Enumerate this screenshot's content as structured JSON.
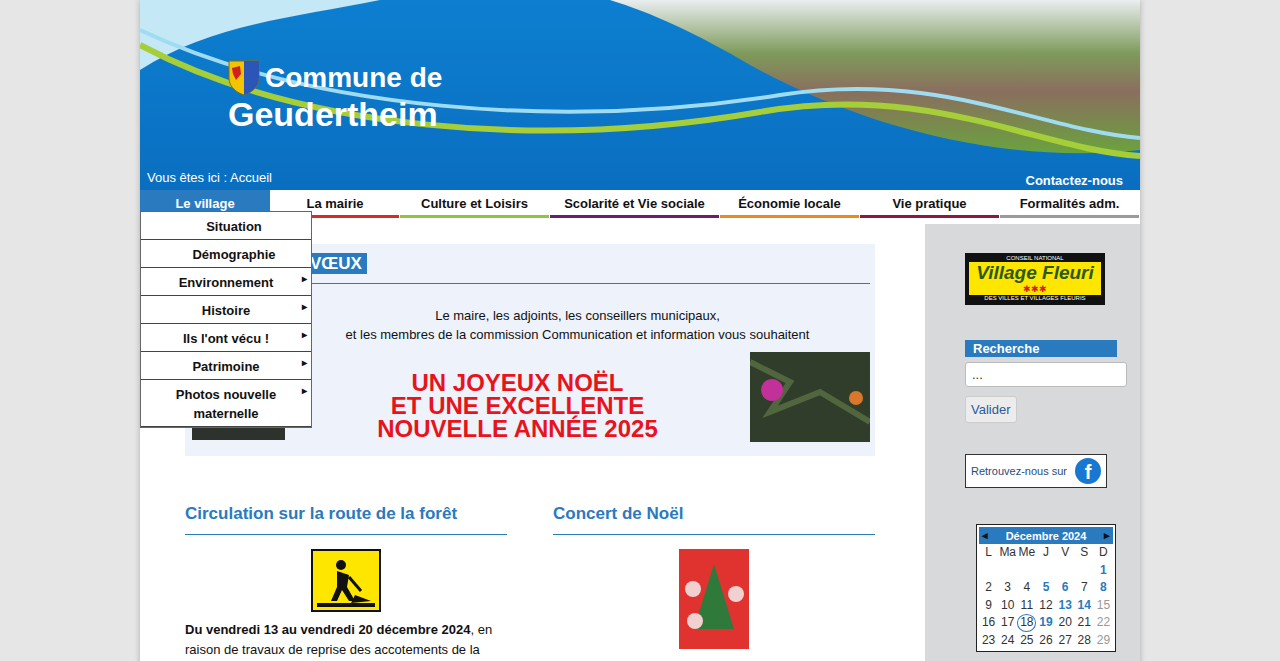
{
  "header": {
    "title_line1": "Commune de",
    "title_line2": "Geudertheim",
    "breadcrumb": "Vous êtes ici : Accueil",
    "contact": "Contactez-nous"
  },
  "nav": {
    "submenu_arrow": "▸",
    "items": [
      {
        "label": "Le village",
        "selected": true,
        "color": "#2a7abf"
      },
      {
        "label": "La mairie",
        "selected": false,
        "color": "#d62b2b"
      },
      {
        "label": "Culture et Loisirs",
        "selected": false,
        "color": "#8cc63f"
      },
      {
        "label": "Scolarité et Vie sociale",
        "selected": false,
        "color": "#6b1d6e"
      },
      {
        "label": "Économie locale",
        "selected": false,
        "color": "#e88a1e"
      },
      {
        "label": "Vie pratique",
        "selected": false,
        "color": "#8e1840"
      },
      {
        "label": "Formalités adm.",
        "selected": false,
        "color": "#9a9a9a"
      }
    ]
  },
  "dropdown": {
    "expanded": true,
    "items": [
      {
        "label": "Situation",
        "submenu": false
      },
      {
        "label": "Démographie",
        "submenu": false
      },
      {
        "label": "Environnement",
        "submenu": true
      },
      {
        "label": "Histoire",
        "submenu": true
      },
      {
        "label": "Ils l'ont vécu !",
        "submenu": true
      },
      {
        "label": "Patrimoine",
        "submenu": true
      },
      {
        "label": "Photos nouvelle maternelle",
        "submenu": true
      }
    ]
  },
  "greeting": {
    "title": "VŒUX",
    "intro": [
      "Le maire, les adjoints, les conseillers municipaux,",
      "et les membres de la commission Communication et information vous souhaitent"
    ],
    "headline": [
      "UN JOYEUX NOËL",
      "ET UNE EXCELLENTE",
      "NOUVELLE ANNÉE 2025"
    ]
  },
  "articles": [
    {
      "title": "Circulation sur la route de la forêt",
      "kind": "roadwork",
      "lead": "Du vendredi 13 au vendredi 20 décembre 2024",
      "text": ", en raison de travaux de reprise des accotements de la"
    },
    {
      "title": "Concert de Noël",
      "kind": "poster"
    }
  ],
  "sidebar": {
    "label": {
      "top": "CONSEIL NATIONAL",
      "name": "Village Fleuri",
      "flowers": "✱✱✱",
      "bottom": "DES VILLES ET VILLAGES FLEURIS"
    },
    "search": {
      "title": "Recherche",
      "placeholder": "...",
      "button": "Valider"
    },
    "facebook": {
      "text": "Retrouvez-nous sur",
      "logo": "f"
    },
    "calendar": {
      "month": "Décembre 2024",
      "prev": "◂",
      "next": "▸",
      "weekdays": [
        "L",
        "Ma",
        "Me",
        "J",
        "V",
        "S",
        "D"
      ],
      "weeks": [
        [
          null,
          null,
          null,
          null,
          null,
          null,
          {
            "d": "1",
            "event": true,
            "today": false
          }
        ],
        [
          {
            "d": "2",
            "event": false,
            "today": false
          },
          {
            "d": "3",
            "event": false,
            "today": false
          },
          {
            "d": "4",
            "event": false,
            "today": false
          },
          {
            "d": "5",
            "event": true,
            "today": false
          },
          {
            "d": "6",
            "event": true,
            "today": false
          },
          {
            "d": "7",
            "event": false,
            "today": false
          },
          {
            "d": "8",
            "event": true,
            "today": false
          }
        ],
        [
          {
            "d": "9",
            "event": false,
            "today": false
          },
          {
            "d": "10",
            "event": false,
            "today": false
          },
          {
            "d": "11",
            "event": false,
            "today": false
          },
          {
            "d": "12",
            "event": false,
            "today": false
          },
          {
            "d": "13",
            "event": true,
            "today": false
          },
          {
            "d": "14",
            "event": true,
            "today": false
          },
          {
            "d": "15",
            "event": false,
            "today": false
          }
        ],
        [
          {
            "d": "16",
            "event": false,
            "today": false
          },
          {
            "d": "17",
            "event": false,
            "today": false
          },
          {
            "d": "18",
            "event": false,
            "today": true
          },
          {
            "d": "19",
            "event": true,
            "today": false
          },
          {
            "d": "20",
            "event": false,
            "today": false
          },
          {
            "d": "21",
            "event": false,
            "today": false
          },
          {
            "d": "22",
            "event": false,
            "today": false
          }
        ],
        [
          {
            "d": "23",
            "event": false,
            "today": false
          },
          {
            "d": "24",
            "event": false,
            "today": false
          },
          {
            "d": "25",
            "event": false,
            "today": false
          },
          {
            "d": "26",
            "event": false,
            "today": false
          },
          {
            "d": "27",
            "event": false,
            "today": false
          },
          {
            "d": "28",
            "event": false,
            "today": false
          },
          {
            "d": "29",
            "event": false,
            "today": false
          }
        ]
      ]
    }
  }
}
